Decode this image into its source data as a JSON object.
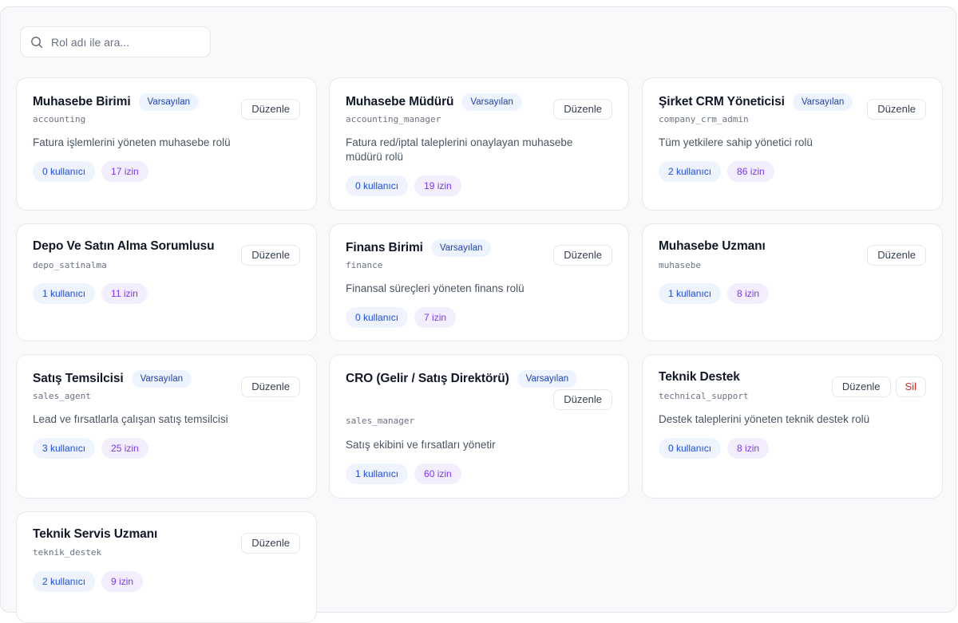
{
  "search": {
    "placeholder": "Rol adı ile ara..."
  },
  "labels": {
    "edit": "Düzenle",
    "delete": "Sil",
    "default_badge": "Varsayılan"
  },
  "roles": [
    {
      "title": "Muhasebe Birimi",
      "default": true,
      "code": "accounting",
      "desc": "Fatura işlemlerini yöneten muhasebe rolü",
      "users": "0 kullanıcı",
      "perms": "17 izin"
    },
    {
      "title": "Muhasebe Müdürü",
      "default": true,
      "code": "accounting_manager",
      "desc": "Fatura red/iptal taleplerini onaylayan muhasebe müdürü rolü",
      "users": "0 kullanıcı",
      "perms": "19 izin"
    },
    {
      "title": "Şirket CRM Yöneticisi",
      "default": true,
      "code": "company_crm_admin",
      "desc": "Tüm yetkilere sahip yönetici rolü",
      "users": "2 kullanıcı",
      "perms": "86 izin"
    },
    {
      "title": "Depo Ve Satın Alma Sorumlusu",
      "default": false,
      "code": "depo_satinalma",
      "desc": "",
      "users": "1 kullanıcı",
      "perms": "11 izin"
    },
    {
      "title": "Finans Birimi",
      "default": true,
      "code": "finance",
      "desc": "Finansal süreçleri yöneten finans rolü",
      "users": "0 kullanıcı",
      "perms": "7 izin"
    },
    {
      "title": "Muhasebe Uzmanı",
      "default": false,
      "code": "muhasebe",
      "desc": "",
      "users": "1 kullanıcı",
      "perms": "8 izin"
    },
    {
      "title": "Satış Temsilcisi",
      "default": true,
      "code": "sales_agent",
      "desc": "Lead ve fırsatlarla çalışan satış temsilcisi",
      "users": "3 kullanıcı",
      "perms": "25 izin"
    },
    {
      "title": "CRO (Gelir / Satış Direktörü)",
      "default": true,
      "code": "sales_manager",
      "desc": "Satış ekibini ve fırsatları yönetir",
      "users": "1 kullanıcı",
      "perms": "60 izin"
    },
    {
      "title": "Teknik Destek",
      "default": false,
      "code": "technical_support",
      "desc": "Destek taleplerini yöneten teknik destek rolü",
      "users": "0 kullanıcı",
      "perms": "8 izin",
      "deletable": true
    },
    {
      "title": "Teknik Servis Uzmanı",
      "default": false,
      "code": "teknik_destek",
      "desc": "",
      "users": "2 kullanıcı",
      "perms": "9 izin"
    }
  ]
}
